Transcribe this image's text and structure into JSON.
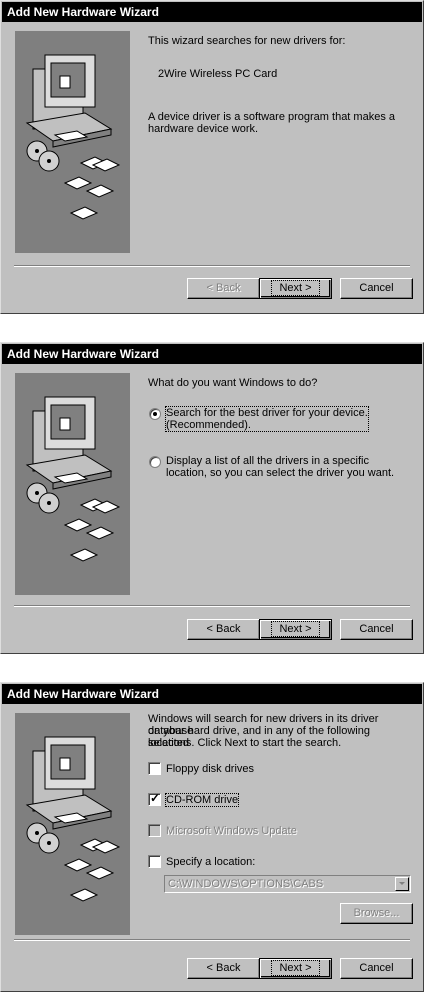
{
  "dialogs": [
    {
      "title": "Add New Hardware Wizard",
      "intro": "This wizard searches for new drivers for:",
      "device": "2Wire Wireless PC Card",
      "desc_line1": "A device driver is a software program that makes a",
      "desc_line2": "hardware device work.",
      "buttons": {
        "back": "< Back",
        "next": "Next >",
        "cancel": "Cancel"
      }
    },
    {
      "title": "Add New Hardware Wizard",
      "question": "What do you want Windows to do?",
      "option1_line1": "Search for the best driver for your device.",
      "option1_line2": "(Recommended).",
      "option2_line1": "Display a list of all the drivers in a specific",
      "option2_line2": "location, so you can select the driver you want.",
      "buttons": {
        "back": "< Back",
        "next": "Next >",
        "cancel": "Cancel"
      }
    },
    {
      "title": "Add New Hardware Wizard",
      "text_line1": "Windows will search for new drivers in its driver database",
      "text_line2": "on your hard drive, and in any of the following selected",
      "text_line3": "locations. Click Next to start the search.",
      "check_floppy": "Floppy disk drives",
      "check_cdrom": "CD-ROM drive",
      "check_update": "Microsoft Windows Update",
      "check_location": "Specify a location:",
      "location_value": "C:\\WINDOWS\\OPTIONS\\CABS",
      "browse": "Browse...",
      "buttons": {
        "back": "< Back",
        "next": "Next >",
        "cancel": "Cancel"
      }
    }
  ]
}
